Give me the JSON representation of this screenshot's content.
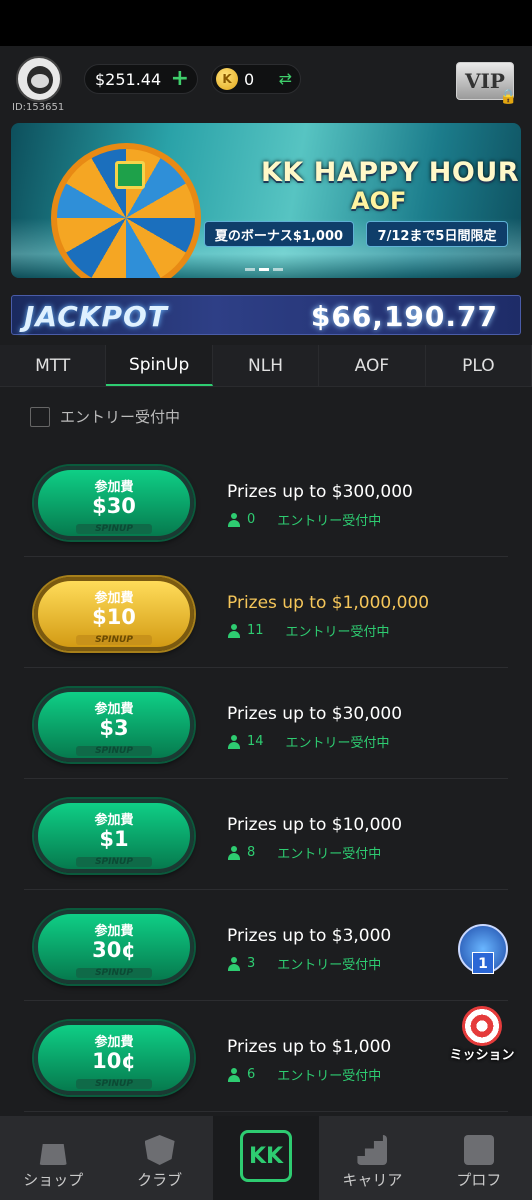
{
  "header": {
    "user_id": "ID:153651",
    "balance": "$251.44",
    "balance_add": "+",
    "coin_symbol": "K",
    "coins": "0",
    "coin_swap": "⇄",
    "vip": "VIP"
  },
  "banner": {
    "title": "KK HAPPY HOUR",
    "subtitle": "AOF",
    "tag1": "夏のボーナス$1,000",
    "tag2": "7/12まで5日間限定"
  },
  "jackpot": {
    "label": "JACKPOT",
    "value": "$66,190.77"
  },
  "tabs": [
    "MTT",
    "SpinUp",
    "NLH",
    "AOF",
    "PLO"
  ],
  "filter": {
    "label": "エントリー受付中"
  },
  "games": [
    {
      "fee_label": "参加費",
      "fee": "$30",
      "brand": "SPINUP",
      "prize": "Prizes up to $300,000",
      "players": "0",
      "status": "エントリー受付中"
    },
    {
      "fee_label": "参加費",
      "fee": "$10",
      "brand": "SPINUP",
      "prize": "Prizes up to $1,000,000",
      "players": "11",
      "status": "エントリー受付中"
    },
    {
      "fee_label": "参加費",
      "fee": "$3",
      "brand": "SPINUP",
      "prize": "Prizes up to $30,000",
      "players": "14",
      "status": "エントリー受付中"
    },
    {
      "fee_label": "参加費",
      "fee": "$1",
      "brand": "SPINUP",
      "prize": "Prizes up to $10,000",
      "players": "8",
      "status": "エントリー受付中"
    },
    {
      "fee_label": "参加費",
      "fee": "30¢",
      "brand": "SPINUP",
      "prize": "Prizes up to $3,000",
      "players": "3",
      "status": "エントリー受付中"
    },
    {
      "fee_label": "参加費",
      "fee": "10¢",
      "brand": "SPINUP",
      "prize": "Prizes up to $1,000",
      "players": "6",
      "status": "エントリー受付中"
    }
  ],
  "floating": {
    "rank_number": "1",
    "mission_label": "ミッション"
  },
  "nav": {
    "shop": "ショップ",
    "club": "クラブ",
    "center": "KK",
    "career": "キャリア",
    "profile": "プロフ"
  },
  "colors": {
    "accent_green": "#2ecc71",
    "gold": "#f5c65a",
    "background": "#1c1d1f"
  }
}
